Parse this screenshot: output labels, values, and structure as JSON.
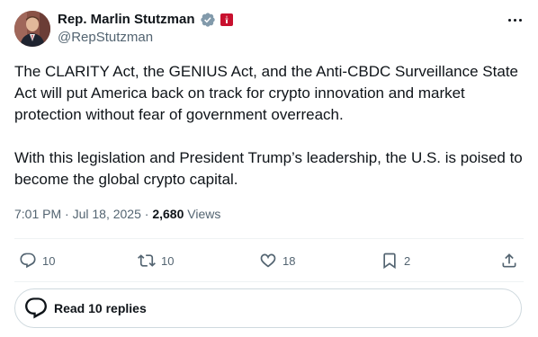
{
  "author": {
    "display_name": "Rep. Marlin Stutzman",
    "handle": "@RepStutzman",
    "verified_badge_color": "#829aab",
    "affiliation_color": "#c8102e"
  },
  "tweet": {
    "paragraphs": [
      "The CLARITY Act, the GENIUS Act, and the Anti-CBDC Surveillance State Act will put America back on track for crypto innovation and market protection without fear of government overreach.",
      "With this legislation and President Trump’s leadership, the U.S. is poised to become the global crypto capital."
    ],
    "time": "7:01 PM",
    "date": "Jul 18, 2025",
    "separator": "·",
    "views_count": "2,680",
    "views_label": "Views"
  },
  "actions": {
    "reply": {
      "icon": "reply-icon",
      "count": "10"
    },
    "repost": {
      "icon": "repost-icon",
      "count": "10"
    },
    "like": {
      "icon": "heart-icon",
      "count": "18"
    },
    "bookmark": {
      "icon": "bookmark-icon",
      "count": "2"
    },
    "share": {
      "icon": "share-icon"
    }
  },
  "read_replies": {
    "label": "Read 10 replies",
    "icon": "speech-bubble-icon"
  },
  "colors": {
    "text_primary": "#0f1419",
    "text_secondary": "#536471",
    "divider": "#eff3f4",
    "border": "#cfd9de"
  }
}
